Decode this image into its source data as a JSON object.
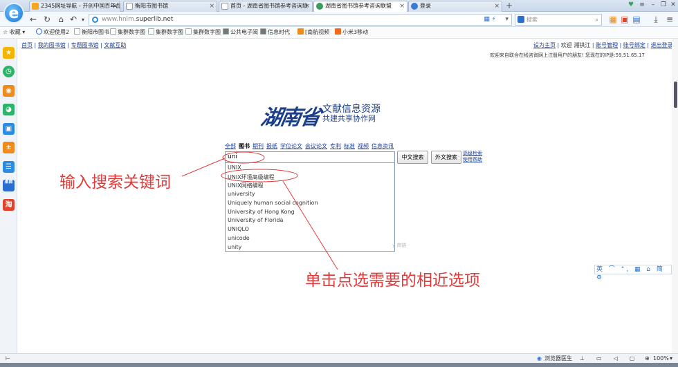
{
  "browser": {
    "tabs": [
      {
        "title": "2345网址导航 - 开创中国百年品",
        "active": false
      },
      {
        "title": "衡阳市图书馆",
        "active": false
      },
      {
        "title": "首页 - 湖南省图书馆参考咨询联",
        "active": false
      },
      {
        "title": "湖南省图书馆参考咨询联盟",
        "active": true
      },
      {
        "title": "登录",
        "active": false
      }
    ],
    "new_tab": "+",
    "url_prefix": "www.hnlm.",
    "url_host": "superlib.net",
    "search_placeholder": "搜索",
    "bookmarks_label": "收藏",
    "bookmarks": [
      "欢迎使用2",
      "衡阳市图书",
      "集群数字图",
      "集群数字图",
      "集群数字图",
      "公共电子阅",
      "信息时代",
      "[南航视频",
      "小米3移动"
    ],
    "status": {
      "browser_label": "浏览器医生",
      "zoom": "100%"
    }
  },
  "page": {
    "top_links_left": [
      "首页",
      "我的图书馆",
      "专题图书馆",
      "文献互助"
    ],
    "top_links_right": [
      "设为主页",
      "欢迎 湘拱江",
      "账号管理",
      "账号绑定",
      "退出登录"
    ],
    "welcome_text": "欢迎来自联合在线咨询网上注册用户的朋友! 您现在的IP是:59.51.65.17",
    "brand_calligraphy": "湖南省",
    "brand_line1": "文献信息资源",
    "brand_line2": "共建共享协作网",
    "categories": [
      "全部",
      "图书",
      "期刊",
      "报纸",
      "学位论文",
      "会议论文",
      "专利",
      "标准",
      "视频",
      "信息资讯"
    ],
    "selected_category": "图书",
    "search_value": "uni",
    "btn_cn": "中文搜索",
    "btn_foreign": "外文搜索",
    "adv_search": "高级检索",
    "help": "使用帮助",
    "suggestions": [
      "UNIX",
      "UNIX环境高级编程",
      "UNIX网络编程",
      "university",
      "Uniquely human social cognition",
      "University of Hong Kong",
      "University of Florida",
      "UNIQLO",
      "unicode",
      "unity"
    ],
    "faint_text": "y 商链"
  },
  "annotations": {
    "label1": "输入搜索关键词",
    "label2": "单击点选需要的相近选项",
    "color": "#e23a3a"
  },
  "ime_bar": "英 ⌒ °, ▦ ⌂ 简 ⚙"
}
